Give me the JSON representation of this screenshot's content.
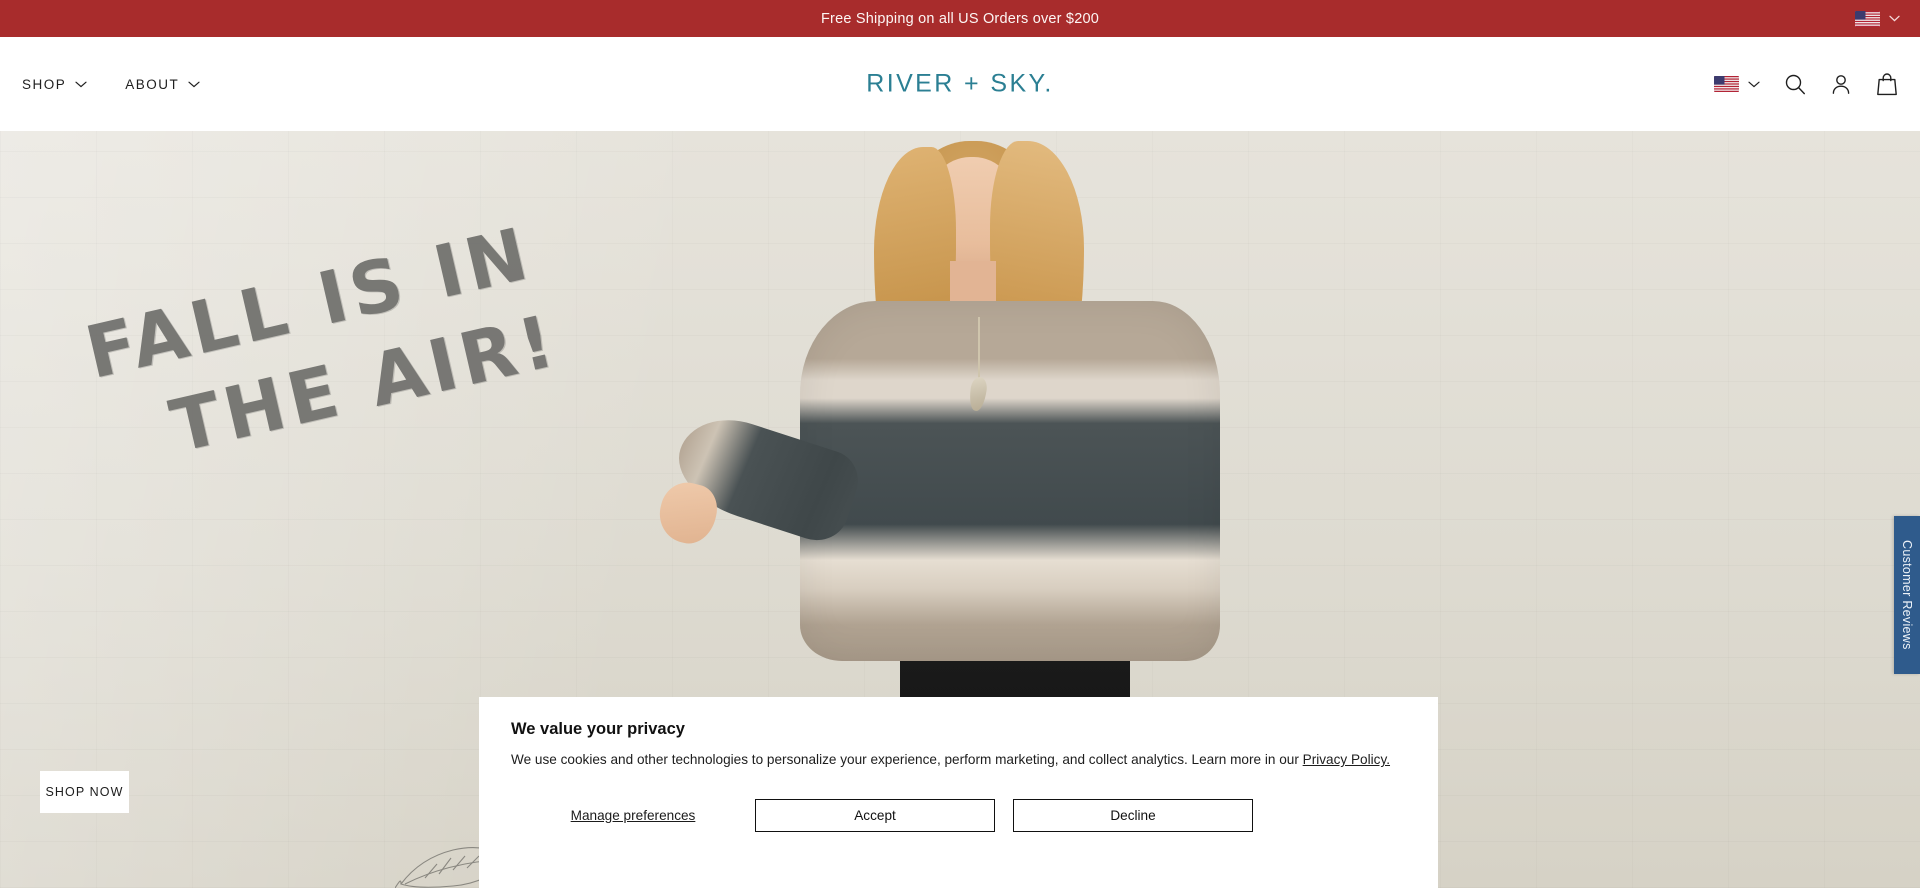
{
  "announcement": {
    "text": "Free Shipping on all US Orders over $200",
    "background_color": "#a82c2c",
    "locale_flag": "us-flag-icon",
    "locale_chevron": "chevron-down-icon"
  },
  "header": {
    "logo": "RIVER + SKY.",
    "logo_color": "#2b7f93",
    "nav": [
      {
        "label": "SHOP",
        "chevron": "chevron-down-icon"
      },
      {
        "label": "ABOUT",
        "chevron": "chevron-down-icon"
      }
    ],
    "icons": [
      {
        "name": "us-flag-icon"
      },
      {
        "name": "chevron-down-icon"
      },
      {
        "name": "search-icon"
      },
      {
        "name": "account-icon"
      },
      {
        "name": "shopping-bag-icon"
      }
    ]
  },
  "hero": {
    "headline_line1": "FALL IS IN",
    "headline_line2": "THE AIR!",
    "cta_label": "SHOP NOW",
    "background_color": "#ded9cf",
    "headline_color": "#6f6f6c",
    "decoration": "leaf-sketch"
  },
  "reviews_tab": {
    "label": "Customer Reviews",
    "glyph": "☐",
    "background_color": "#2f5b8c"
  },
  "cookie_banner": {
    "title": "We value your privacy",
    "body_before_link": "We use cookies and other technologies to personalize your experience, perform marketing, and collect analytics. Learn more in our ",
    "link_text": "Privacy Policy.",
    "manage_label": "Manage preferences",
    "accept_label": "Accept",
    "decline_label": "Decline"
  }
}
